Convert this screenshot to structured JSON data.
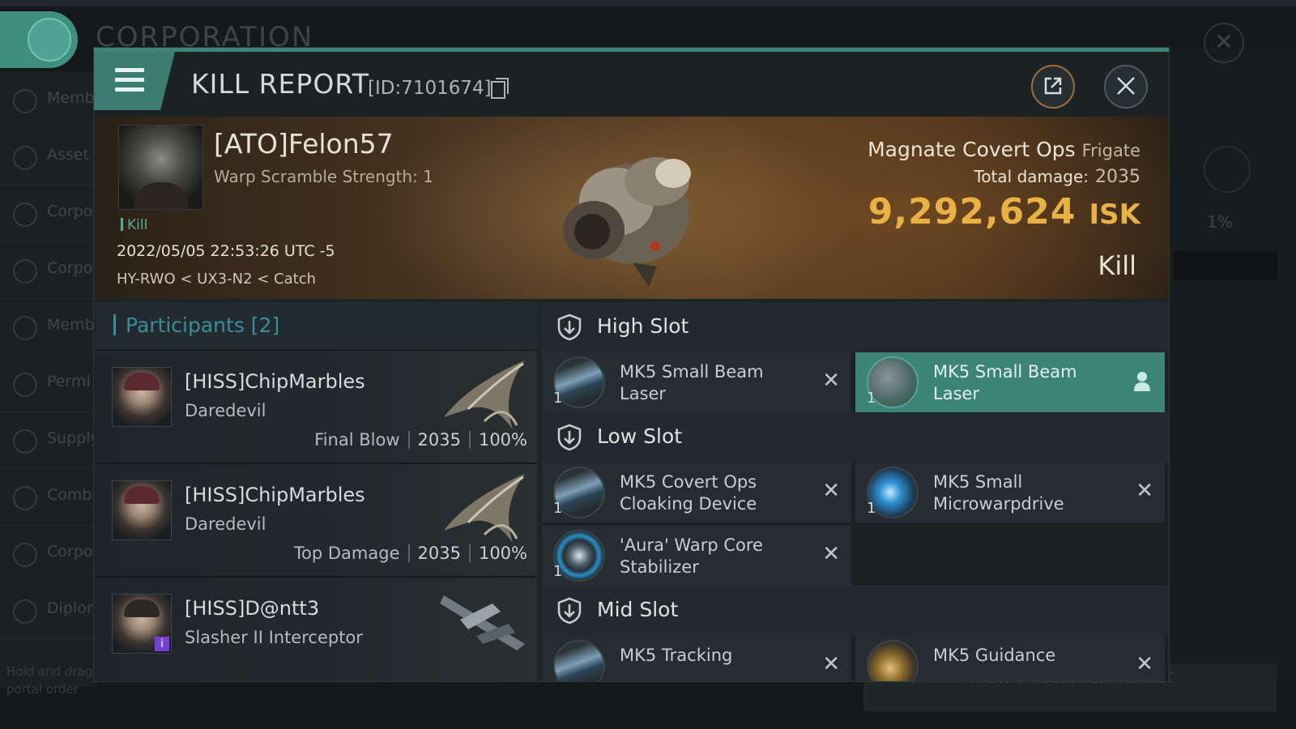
{
  "background": {
    "title": "CORPORATION",
    "sidebar": [
      "Memb",
      "Asset",
      "Corpo",
      "Corpo",
      "Memb Applic",
      "Permi Manag",
      "Supply",
      "Comba",
      "Corpo",
      "Diplon"
    ],
    "hint": "Hold and drag feature portal order",
    "percent": "1%",
    "bottom_button": "View Missions/Market"
  },
  "dialog": {
    "title": "KILL REPORT",
    "id_text": "[ID:7101674]"
  },
  "victim": {
    "name": "[ATO]Felon57",
    "subtitle": "Warp Scramble Strength: 1",
    "tag": "Kill",
    "datetime": "2022/05/05 22:53:26 UTC -5",
    "location": "HY-RWO < UX3-N2 < Catch",
    "ship_name": "Magnate Covert Ops",
    "ship_class": "Frigate",
    "total_damage_label": "Total damage:",
    "total_damage": "2035",
    "isk_value": "9,292,624",
    "isk_unit": "ISK",
    "result": "Kill"
  },
  "participants": {
    "title": "Participants [2]",
    "rows": [
      {
        "name": "[HISS]ChipMarbles",
        "ship": "Daredevil",
        "label": "Final Blow",
        "damage": "2035",
        "percent": "100%"
      },
      {
        "name": "[HISS]ChipMarbles",
        "ship": "Daredevil",
        "label": "Top Damage",
        "damage": "2035",
        "percent": "100%"
      },
      {
        "name": "[HISS]D@ntt3",
        "ship": "Slasher II Interceptor",
        "label": "",
        "damage": "",
        "percent": ""
      }
    ]
  },
  "fitting": {
    "high_slot": {
      "title": "High Slot",
      "modules": [
        {
          "name": "MK5 Small Beam Laser",
          "qty": "1",
          "status": "destroyed"
        },
        {
          "name": "MK5 Small Beam Laser",
          "qty": "1",
          "status": "dropped"
        }
      ]
    },
    "low_slot": {
      "title": "Low Slot",
      "modules": [
        {
          "name": "MK5 Covert Ops Cloaking Device",
          "qty": "1",
          "status": "destroyed"
        },
        {
          "name": "MK5 Small Microwarpdrive",
          "qty": "1",
          "status": "destroyed"
        },
        {
          "name": "'Aura' Warp Core Stabilizer",
          "qty": "1",
          "status": "destroyed"
        }
      ]
    },
    "mid_slot": {
      "title": "Mid Slot",
      "modules": [
        {
          "name": "MK5 Tracking",
          "qty": "",
          "status": "destroyed"
        },
        {
          "name": "MK5 Guidance",
          "qty": "",
          "status": "destroyed"
        }
      ]
    }
  },
  "colors": {
    "accent_teal": "#3f8479",
    "isk_gold": "#e9b042",
    "participants_title": "#3c8c9a",
    "highlight_module": "#3c8478"
  },
  "icons": [
    "menu-icon",
    "copy-icon",
    "share-icon",
    "close-icon",
    "slot-shield-icon",
    "x-icon",
    "user-icon",
    "info-icon"
  ]
}
